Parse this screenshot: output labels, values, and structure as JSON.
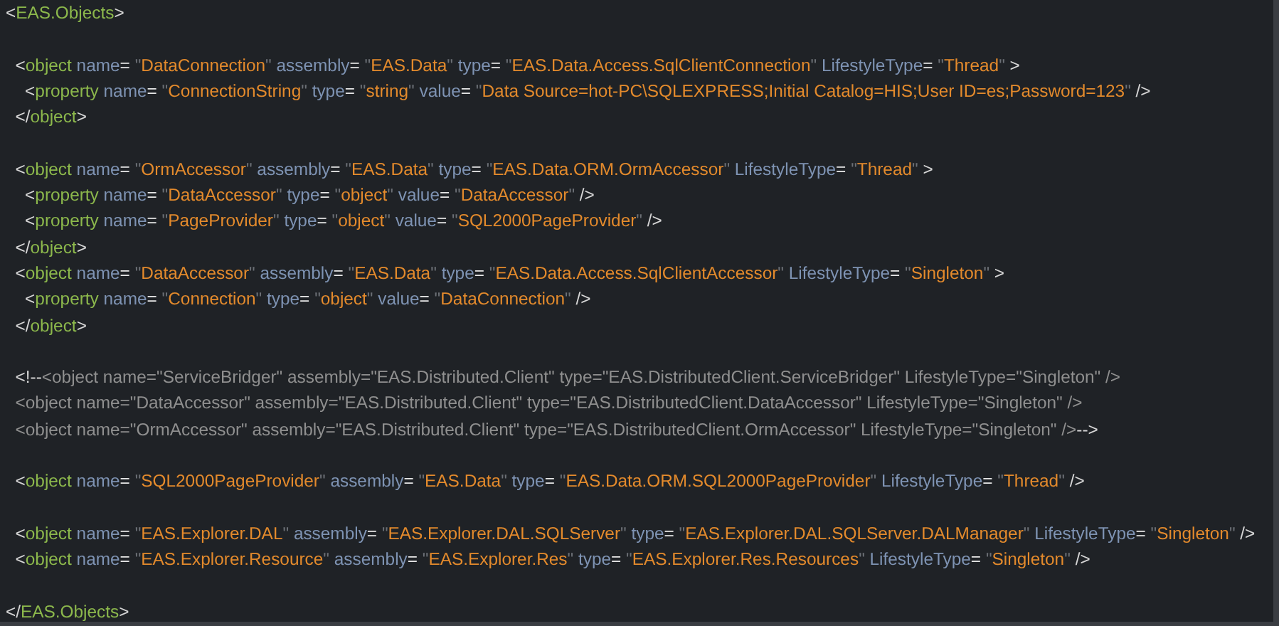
{
  "editor": {
    "lines": [
      {
        "kind": "code",
        "tokens": [
          {
            "kind": "punct",
            "text": "<"
          },
          {
            "kind": "tag",
            "text": "EAS.Objects"
          },
          {
            "kind": "punct",
            "text": ">"
          }
        ]
      },
      {
        "kind": "blank"
      },
      {
        "kind": "code",
        "tokens": [
          {
            "kind": "punct",
            "text": "  <"
          },
          {
            "kind": "tag",
            "text": "object"
          },
          {
            "kind": "attr",
            "text": " name"
          },
          {
            "kind": "eq",
            "text": "= "
          },
          {
            "kind": "quote",
            "text": "\""
          },
          {
            "kind": "value",
            "text": "DataConnection"
          },
          {
            "kind": "quote",
            "text": "\" "
          },
          {
            "kind": "attr",
            "text": "assembly"
          },
          {
            "kind": "eq",
            "text": "= "
          },
          {
            "kind": "quote",
            "text": "\""
          },
          {
            "kind": "value",
            "text": "EAS.Data"
          },
          {
            "kind": "quote",
            "text": "\" "
          },
          {
            "kind": "attr",
            "text": "type"
          },
          {
            "kind": "eq",
            "text": "= "
          },
          {
            "kind": "quote",
            "text": "\""
          },
          {
            "kind": "value",
            "text": "EAS.Data.Access.SqlClientConnection"
          },
          {
            "kind": "quote",
            "text": "\" "
          },
          {
            "kind": "attr",
            "text": "LifestyleType"
          },
          {
            "kind": "eq",
            "text": "= "
          },
          {
            "kind": "quote",
            "text": "\""
          },
          {
            "kind": "value",
            "text": "Thread"
          },
          {
            "kind": "quote",
            "text": "\" "
          },
          {
            "kind": "punct",
            "text": ">"
          }
        ]
      },
      {
        "kind": "code",
        "tokens": [
          {
            "kind": "punct",
            "text": "    <"
          },
          {
            "kind": "tag",
            "text": "property"
          },
          {
            "kind": "attr",
            "text": " name"
          },
          {
            "kind": "eq",
            "text": "= "
          },
          {
            "kind": "quote",
            "text": "\""
          },
          {
            "kind": "value",
            "text": "ConnectionString"
          },
          {
            "kind": "quote",
            "text": "\" "
          },
          {
            "kind": "attr",
            "text": "type"
          },
          {
            "kind": "eq",
            "text": "= "
          },
          {
            "kind": "quote",
            "text": "\""
          },
          {
            "kind": "value",
            "text": "string"
          },
          {
            "kind": "quote",
            "text": "\" "
          },
          {
            "kind": "attr",
            "text": "value"
          },
          {
            "kind": "eq",
            "text": "= "
          },
          {
            "kind": "quote",
            "text": "\""
          },
          {
            "kind": "value",
            "text": "Data Source=hot-PC\\SQLEXPRESS;Initial Catalog=HIS;User ID=es;Password=123"
          },
          {
            "kind": "quote",
            "text": "\" "
          },
          {
            "kind": "punct",
            "text": "/>"
          }
        ]
      },
      {
        "kind": "code",
        "tokens": [
          {
            "kind": "punct",
            "text": "  </"
          },
          {
            "kind": "tag",
            "text": "object"
          },
          {
            "kind": "punct",
            "text": ">"
          }
        ]
      },
      {
        "kind": "blank"
      },
      {
        "kind": "code",
        "tokens": [
          {
            "kind": "punct",
            "text": "  <"
          },
          {
            "kind": "tag",
            "text": "object"
          },
          {
            "kind": "attr",
            "text": " name"
          },
          {
            "kind": "eq",
            "text": "= "
          },
          {
            "kind": "quote",
            "text": "\""
          },
          {
            "kind": "value",
            "text": "OrmAccessor"
          },
          {
            "kind": "quote",
            "text": "\" "
          },
          {
            "kind": "attr",
            "text": "assembly"
          },
          {
            "kind": "eq",
            "text": "= "
          },
          {
            "kind": "quote",
            "text": "\""
          },
          {
            "kind": "value",
            "text": "EAS.Data"
          },
          {
            "kind": "quote",
            "text": "\" "
          },
          {
            "kind": "attr",
            "text": "type"
          },
          {
            "kind": "eq",
            "text": "= "
          },
          {
            "kind": "quote",
            "text": "\""
          },
          {
            "kind": "value",
            "text": "EAS.Data.ORM.OrmAccessor"
          },
          {
            "kind": "quote",
            "text": "\" "
          },
          {
            "kind": "attr",
            "text": "LifestyleType"
          },
          {
            "kind": "eq",
            "text": "= "
          },
          {
            "kind": "quote",
            "text": "\""
          },
          {
            "kind": "value",
            "text": "Thread"
          },
          {
            "kind": "quote",
            "text": "\" "
          },
          {
            "kind": "punct",
            "text": ">"
          }
        ]
      },
      {
        "kind": "code",
        "tokens": [
          {
            "kind": "punct",
            "text": "    <"
          },
          {
            "kind": "tag",
            "text": "property"
          },
          {
            "kind": "attr",
            "text": " name"
          },
          {
            "kind": "eq",
            "text": "= "
          },
          {
            "kind": "quote",
            "text": "\""
          },
          {
            "kind": "value",
            "text": "DataAccessor"
          },
          {
            "kind": "quote",
            "text": "\" "
          },
          {
            "kind": "attr",
            "text": "type"
          },
          {
            "kind": "eq",
            "text": "= "
          },
          {
            "kind": "quote",
            "text": "\""
          },
          {
            "kind": "value",
            "text": "object"
          },
          {
            "kind": "quote",
            "text": "\" "
          },
          {
            "kind": "attr",
            "text": "value"
          },
          {
            "kind": "eq",
            "text": "= "
          },
          {
            "kind": "quote",
            "text": "\""
          },
          {
            "kind": "value",
            "text": "DataAccessor"
          },
          {
            "kind": "quote",
            "text": "\" "
          },
          {
            "kind": "punct",
            "text": "/>"
          }
        ]
      },
      {
        "kind": "code",
        "tokens": [
          {
            "kind": "punct",
            "text": "    <"
          },
          {
            "kind": "tag",
            "text": "property"
          },
          {
            "kind": "attr",
            "text": " name"
          },
          {
            "kind": "eq",
            "text": "= "
          },
          {
            "kind": "quote",
            "text": "\""
          },
          {
            "kind": "value",
            "text": "PageProvider"
          },
          {
            "kind": "quote",
            "text": "\" "
          },
          {
            "kind": "attr",
            "text": "type"
          },
          {
            "kind": "eq",
            "text": "= "
          },
          {
            "kind": "quote",
            "text": "\""
          },
          {
            "kind": "value",
            "text": "object"
          },
          {
            "kind": "quote",
            "text": "\" "
          },
          {
            "kind": "attr",
            "text": "value"
          },
          {
            "kind": "eq",
            "text": "= "
          },
          {
            "kind": "quote",
            "text": "\""
          },
          {
            "kind": "value",
            "text": "SQL2000PageProvider"
          },
          {
            "kind": "quote",
            "text": "\" "
          },
          {
            "kind": "punct",
            "text": "/>"
          }
        ]
      },
      {
        "kind": "code",
        "tokens": [
          {
            "kind": "punct",
            "text": "  </"
          },
          {
            "kind": "tag",
            "text": "object"
          },
          {
            "kind": "punct",
            "text": ">"
          }
        ]
      },
      {
        "kind": "code",
        "tokens": [
          {
            "kind": "punct",
            "text": "  <"
          },
          {
            "kind": "tag",
            "text": "object"
          },
          {
            "kind": "attr",
            "text": " name"
          },
          {
            "kind": "eq",
            "text": "= "
          },
          {
            "kind": "quote",
            "text": "\""
          },
          {
            "kind": "value",
            "text": "DataAccessor"
          },
          {
            "kind": "quote",
            "text": "\" "
          },
          {
            "kind": "attr",
            "text": "assembly"
          },
          {
            "kind": "eq",
            "text": "= "
          },
          {
            "kind": "quote",
            "text": "\""
          },
          {
            "kind": "value",
            "text": "EAS.Data"
          },
          {
            "kind": "quote",
            "text": "\" "
          },
          {
            "kind": "attr",
            "text": "type"
          },
          {
            "kind": "eq",
            "text": "= "
          },
          {
            "kind": "quote",
            "text": "\""
          },
          {
            "kind": "value",
            "text": "EAS.Data.Access.SqlClientAccessor"
          },
          {
            "kind": "quote",
            "text": "\" "
          },
          {
            "kind": "attr",
            "text": "LifestyleType"
          },
          {
            "kind": "eq",
            "text": "= "
          },
          {
            "kind": "quote",
            "text": "\""
          },
          {
            "kind": "value",
            "text": "Singleton"
          },
          {
            "kind": "quote",
            "text": "\" "
          },
          {
            "kind": "punct",
            "text": ">"
          }
        ]
      },
      {
        "kind": "code",
        "tokens": [
          {
            "kind": "punct",
            "text": "    <"
          },
          {
            "kind": "tag",
            "text": "property"
          },
          {
            "kind": "attr",
            "text": " name"
          },
          {
            "kind": "eq",
            "text": "= "
          },
          {
            "kind": "quote",
            "text": "\""
          },
          {
            "kind": "value",
            "text": "Connection"
          },
          {
            "kind": "quote",
            "text": "\" "
          },
          {
            "kind": "attr",
            "text": "type"
          },
          {
            "kind": "eq",
            "text": "= "
          },
          {
            "kind": "quote",
            "text": "\""
          },
          {
            "kind": "value",
            "text": "object"
          },
          {
            "kind": "quote",
            "text": "\" "
          },
          {
            "kind": "attr",
            "text": "value"
          },
          {
            "kind": "eq",
            "text": "= "
          },
          {
            "kind": "quote",
            "text": "\""
          },
          {
            "kind": "value",
            "text": "DataConnection"
          },
          {
            "kind": "quote",
            "text": "\" "
          },
          {
            "kind": "punct",
            "text": "/>"
          }
        ]
      },
      {
        "kind": "code",
        "tokens": [
          {
            "kind": "punct",
            "text": "  </"
          },
          {
            "kind": "tag",
            "text": "object"
          },
          {
            "kind": "punct",
            "text": ">"
          }
        ]
      },
      {
        "kind": "blank"
      },
      {
        "kind": "code",
        "tokens": [
          {
            "kind": "punct",
            "text": "  <!--"
          },
          {
            "kind": "comment",
            "text": "<object name=\"ServiceBridger\" assembly=\"EAS.Distributed.Client\" type=\"EAS.DistributedClient.ServiceBridger\" LifestyleType=\"Singleton\" />"
          }
        ]
      },
      {
        "kind": "code",
        "tokens": [
          {
            "kind": "comment",
            "text": "  <object name=\"DataAccessor\" assembly=\"EAS.Distributed.Client\" type=\"EAS.DistributedClient.DataAccessor\" LifestyleType=\"Singleton\" />"
          }
        ]
      },
      {
        "kind": "code",
        "tokens": [
          {
            "kind": "comment",
            "text": "  <object name=\"OrmAccessor\" assembly=\"EAS.Distributed.Client\" type=\"EAS.DistributedClient.OrmAccessor\" LifestyleType=\"Singleton\" />"
          },
          {
            "kind": "punct",
            "text": "-->"
          }
        ]
      },
      {
        "kind": "blank"
      },
      {
        "kind": "code",
        "tokens": [
          {
            "kind": "punct",
            "text": "  <"
          },
          {
            "kind": "tag",
            "text": "object"
          },
          {
            "kind": "attr",
            "text": " name"
          },
          {
            "kind": "eq",
            "text": "= "
          },
          {
            "kind": "quote",
            "text": "\""
          },
          {
            "kind": "value",
            "text": "SQL2000PageProvider"
          },
          {
            "kind": "quote",
            "text": "\" "
          },
          {
            "kind": "attr",
            "text": "assembly"
          },
          {
            "kind": "eq",
            "text": "= "
          },
          {
            "kind": "quote",
            "text": "\""
          },
          {
            "kind": "value",
            "text": "EAS.Data"
          },
          {
            "kind": "quote",
            "text": "\" "
          },
          {
            "kind": "attr",
            "text": "type"
          },
          {
            "kind": "eq",
            "text": "= "
          },
          {
            "kind": "quote",
            "text": "\""
          },
          {
            "kind": "value",
            "text": "EAS.Data.ORM.SQL2000PageProvider"
          },
          {
            "kind": "quote",
            "text": "\" "
          },
          {
            "kind": "attr",
            "text": "LifestyleType"
          },
          {
            "kind": "eq",
            "text": "= "
          },
          {
            "kind": "quote",
            "text": "\""
          },
          {
            "kind": "value",
            "text": "Thread"
          },
          {
            "kind": "quote",
            "text": "\" "
          },
          {
            "kind": "punct",
            "text": "/>"
          }
        ]
      },
      {
        "kind": "blank"
      },
      {
        "kind": "code",
        "tokens": [
          {
            "kind": "punct",
            "text": "  <"
          },
          {
            "kind": "tag",
            "text": "object"
          },
          {
            "kind": "attr",
            "text": " name"
          },
          {
            "kind": "eq",
            "text": "= "
          },
          {
            "kind": "quote",
            "text": "\""
          },
          {
            "kind": "value",
            "text": "EAS.Explorer.DAL"
          },
          {
            "kind": "quote",
            "text": "\" "
          },
          {
            "kind": "attr",
            "text": "assembly"
          },
          {
            "kind": "eq",
            "text": "= "
          },
          {
            "kind": "quote",
            "text": "\""
          },
          {
            "kind": "value",
            "text": "EAS.Explorer.DAL.SQLServer"
          },
          {
            "kind": "quote",
            "text": "\" "
          },
          {
            "kind": "attr",
            "text": "type"
          },
          {
            "kind": "eq",
            "text": "= "
          },
          {
            "kind": "quote",
            "text": "\""
          },
          {
            "kind": "value",
            "text": "EAS.Explorer.DAL.SQLServer.DALManager"
          },
          {
            "kind": "quote",
            "text": "\" "
          },
          {
            "kind": "attr",
            "text": "LifestyleType"
          },
          {
            "kind": "eq",
            "text": "= "
          },
          {
            "kind": "quote",
            "text": "\""
          },
          {
            "kind": "value",
            "text": "Singleton"
          },
          {
            "kind": "quote",
            "text": "\" "
          },
          {
            "kind": "punct",
            "text": "/>"
          }
        ]
      },
      {
        "kind": "code",
        "tokens": [
          {
            "kind": "punct",
            "text": "  <"
          },
          {
            "kind": "tag",
            "text": "object"
          },
          {
            "kind": "attr",
            "text": " name"
          },
          {
            "kind": "eq",
            "text": "= "
          },
          {
            "kind": "quote",
            "text": "\""
          },
          {
            "kind": "value",
            "text": "EAS.Explorer.Resource"
          },
          {
            "kind": "quote",
            "text": "\" "
          },
          {
            "kind": "attr",
            "text": "assembly"
          },
          {
            "kind": "eq",
            "text": "= "
          },
          {
            "kind": "quote",
            "text": "\""
          },
          {
            "kind": "value",
            "text": "EAS.Explorer.Res"
          },
          {
            "kind": "quote",
            "text": "\" "
          },
          {
            "kind": "attr",
            "text": "type"
          },
          {
            "kind": "eq",
            "text": "= "
          },
          {
            "kind": "quote",
            "text": "\""
          },
          {
            "kind": "value",
            "text": "EAS.Explorer.Res.Resources"
          },
          {
            "kind": "quote",
            "text": "\" "
          },
          {
            "kind": "attr",
            "text": "LifestyleType"
          },
          {
            "kind": "eq",
            "text": "= "
          },
          {
            "kind": "quote",
            "text": "\""
          },
          {
            "kind": "value",
            "text": "Singleton"
          },
          {
            "kind": "quote",
            "text": "\" "
          },
          {
            "kind": "punct",
            "text": "/>"
          }
        ]
      },
      {
        "kind": "blank"
      },
      {
        "kind": "code",
        "tokens": [
          {
            "kind": "punct",
            "text": "</"
          },
          {
            "kind": "tag",
            "text": "EAS.Objects"
          },
          {
            "kind": "punct",
            "text": ">"
          }
        ]
      }
    ]
  }
}
